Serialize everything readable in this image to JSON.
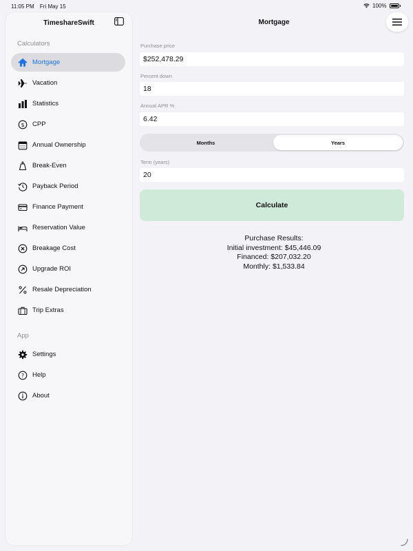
{
  "status_bar": {
    "time": "11:05 PM",
    "date": "Fri May 15",
    "battery": "100%"
  },
  "sidebar": {
    "title": "TimeshareSwift",
    "sections": [
      {
        "header": "Calculators",
        "items": [
          {
            "label": "Mortgage",
            "icon": "house-icon",
            "active": true
          },
          {
            "label": "Vacation",
            "icon": "airplane-icon"
          },
          {
            "label": "Statistics",
            "icon": "bar-chart-icon"
          },
          {
            "label": "CPP",
            "icon": "dollar-circle-icon"
          },
          {
            "label": "Annual Ownership",
            "icon": "calendar-icon"
          },
          {
            "label": "Break-Even",
            "icon": "scale-icon"
          },
          {
            "label": "Payback Period",
            "icon": "clock-arrow-icon"
          },
          {
            "label": "Finance Payment",
            "icon": "credit-card-icon"
          },
          {
            "label": "Reservation Value",
            "icon": "bed-icon"
          },
          {
            "label": "Breakage Cost",
            "icon": "x-circle-icon"
          },
          {
            "label": "Upgrade ROI",
            "icon": "arrow-up-right-circle-icon"
          },
          {
            "label": "Resale Depreciation",
            "icon": "percent-icon"
          },
          {
            "label": "Trip Extras",
            "icon": "suitcase-icon"
          }
        ]
      },
      {
        "header": "App",
        "items": [
          {
            "label": "Settings",
            "icon": "gear-icon"
          },
          {
            "label": "Help",
            "icon": "question-circle-icon"
          },
          {
            "label": "About",
            "icon": "info-circle-icon"
          }
        ]
      }
    ]
  },
  "main": {
    "title": "Mortgage",
    "fields": [
      {
        "label": "Purchase price",
        "value": "$252,478.29"
      },
      {
        "label": "Percent down",
        "value": "18"
      },
      {
        "label": "Annual APR %",
        "value": "6.42"
      },
      {
        "label": "Term (years)",
        "value": "20"
      }
    ],
    "segments": [
      {
        "label": "Months",
        "selected": false
      },
      {
        "label": "Years",
        "selected": true
      }
    ],
    "calculate_label": "Calculate",
    "results": {
      "heading": "Purchase Results:",
      "initial": "Initial investment: $45,446.09",
      "financed": "Financed: $207,032.20",
      "monthly": "Monthly: $1,533.84"
    }
  },
  "colors": {
    "accent": "#1a73e8",
    "calculate_bg": "#d0ead9",
    "background": "#f2f2f7"
  }
}
